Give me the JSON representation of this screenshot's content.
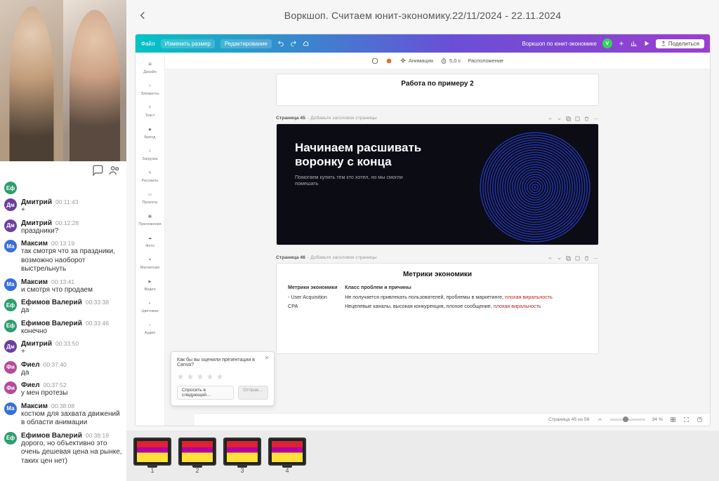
{
  "title": "Воркшоп. Считаем юнит-экономику.22/11/2024 - 22.11.2024",
  "chat": [
    {
      "avatar": "Еф",
      "cls": "av-green",
      "name": "",
      "time": "",
      "text": ""
    },
    {
      "avatar": "Дм",
      "cls": "av-purple",
      "name": "Дмитрий",
      "time": "00:11:43",
      "text": "+"
    },
    {
      "avatar": "Дм",
      "cls": "av-purple",
      "name": "Дмитрий",
      "time": "00:12:28",
      "text": "праздники?"
    },
    {
      "avatar": "Ма",
      "cls": "av-blue",
      "name": "Максим",
      "time": "00:13:19",
      "text": "так смотря что за праздники, возможно наоборот выстрельнуть"
    },
    {
      "avatar": "Ма",
      "cls": "av-blue",
      "name": "Максим",
      "time": "00:13:41",
      "text": "и смотря что продаем"
    },
    {
      "avatar": "Еф",
      "cls": "av-green",
      "name": "Ефимов Валерий",
      "time": "00:33:38",
      "text": "да"
    },
    {
      "avatar": "Еф",
      "cls": "av-green",
      "name": "Ефимов Валерий",
      "time": "00:33:46",
      "text": "конечно"
    },
    {
      "avatar": "Дм",
      "cls": "av-purple",
      "name": "Дмитрий",
      "time": "00:33:50",
      "text": "+"
    },
    {
      "avatar": "Фи",
      "cls": "av-pink",
      "name": "Фиел",
      "time": "00:37:40",
      "text": "да"
    },
    {
      "avatar": "Фи",
      "cls": "av-pink",
      "name": "Фиел",
      "time": "00:37:52",
      "text": "у мен протезы"
    },
    {
      "avatar": "Ма",
      "cls": "av-blue",
      "name": "Максим",
      "time": "00:38:08",
      "text": "костюм для захвата движений в области анимации"
    },
    {
      "avatar": "Еф",
      "cls": "av-green",
      "name": "Ефимов Валерий",
      "time": "00:38:19",
      "text": "дорого, но объективно это очень дешевая цена на рынке, таких цен нет)"
    }
  ],
  "canva": {
    "menu": {
      "file": "Файл",
      "resize": "Изменить размер",
      "edit": "Редактирование"
    },
    "right": {
      "label": "Воркшоп по юнит-экономике",
      "avatar": "V",
      "share": "Поделиться"
    },
    "tools": [
      "Дизайн",
      "Элементы",
      "Текст",
      "Бренд",
      "Загрузки",
      "Рисовать",
      "Проекты",
      "Приложения",
      "Фото",
      "Магнитная",
      "Видео",
      "Цветовая",
      "Аудио"
    ],
    "context": {
      "animation": "Анимация",
      "timer": "5,0 с",
      "position": "Расположение"
    },
    "page44": {
      "title": "Работа по примеру 2"
    },
    "page45": {
      "caption_num": "Страница 45",
      "caption_tail": "- Добавьте заголовок страницы",
      "headline": "Начинаем расшивать воронку с конца",
      "sub": "Помогаем купить тем кто хотел, но мы смогли помешать"
    },
    "page46": {
      "caption_num": "Страница 46",
      "caption_tail": "- Добавьте заголовок страницы",
      "title": "Метрики экономики",
      "headers": [
        "Метрики экономики",
        "Класс проблем и причины"
      ],
      "rows": [
        [
          "- User Acquisition",
          "Не получается привлекать пользователей, проблемы в маркетинге, плохая виральность"
        ],
        [
          "CPA",
          "Нецелевые каналы, высокая конкуренция, плохое сообщение, плохая виральность"
        ]
      ]
    },
    "survey": {
      "q": "Как бы вы оценили презентации в Canva?",
      "skip": "Спросить в следующий…",
      "send": "Отправ…"
    },
    "status": {
      "page": "Страница 45 из 56",
      "zoom": "34 %"
    }
  },
  "thumbs": [
    "1",
    "2",
    "3",
    "4"
  ]
}
